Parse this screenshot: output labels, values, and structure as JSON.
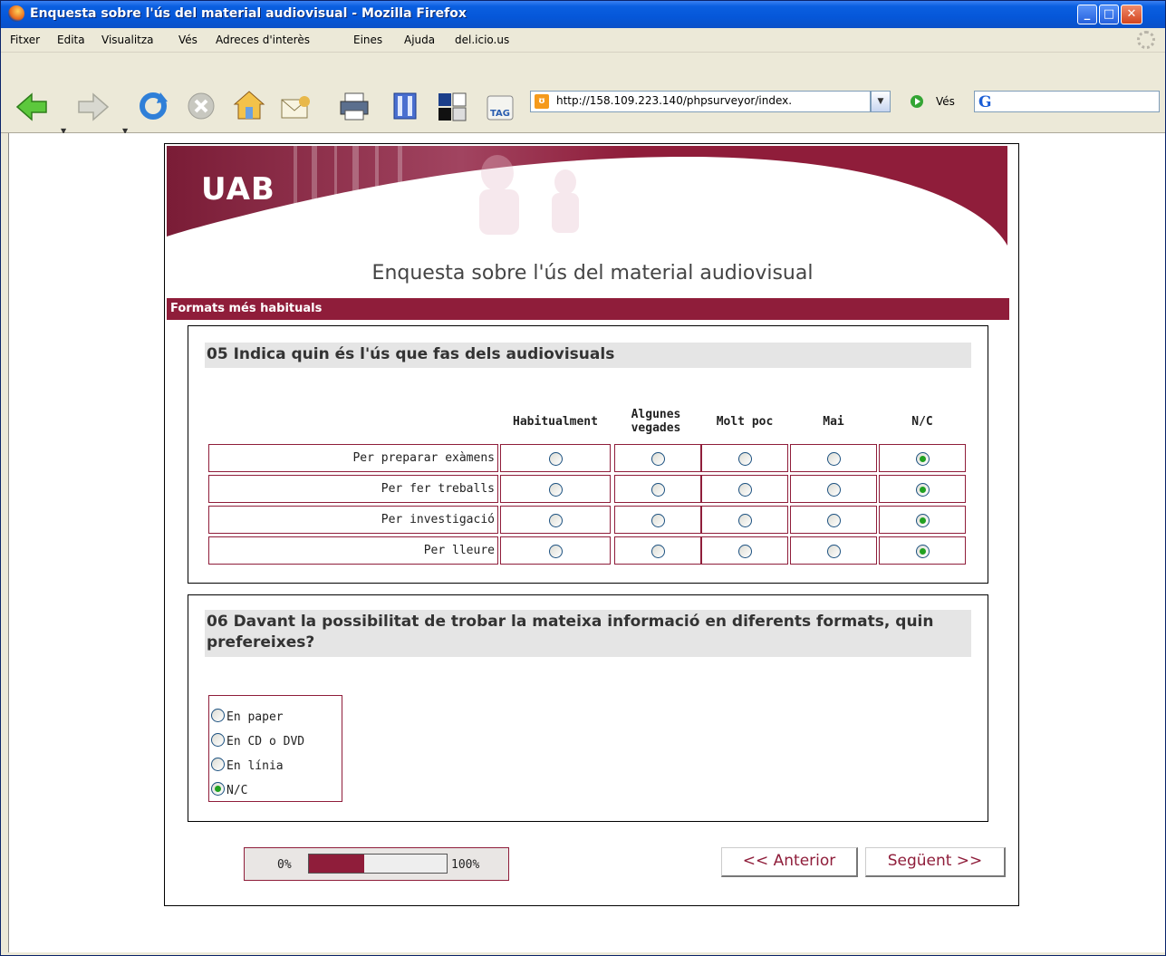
{
  "window": {
    "title": "Enquesta sobre l'ús del material audiovisual - Mozilla Firefox",
    "controls": {
      "minimize": "_",
      "maximize": "□",
      "close": "✕"
    }
  },
  "menubar": {
    "items": [
      "Fitxer",
      "Edita",
      "Visualitza",
      "Vés",
      "Adreces d'interès",
      "Eines",
      "Ajuda",
      "del.icio.us"
    ]
  },
  "toolbar": {
    "url": "http://158.109.223.140/phpsurveyor/index.",
    "go_label": "Vés",
    "search_engine": "G",
    "buttons": [
      "back",
      "forward",
      "reload",
      "stop",
      "home",
      "mail",
      "print",
      "bookmarks",
      "page-layout",
      "tag"
    ]
  },
  "page": {
    "logo": "UAB",
    "survey_title": "Enquesta sobre l'ús del material audiovisual",
    "group_title": "Formats més habituals",
    "colors": {
      "accent": "#8f1d3a",
      "radio_selected": "#21a121"
    }
  },
  "q5": {
    "title": "05 Indica quin és l'ús que fas dels audiovisuals",
    "columns": [
      "Habitualment",
      "Algunes vegades",
      "Molt poc",
      "Mai",
      "N/C"
    ],
    "rows": [
      {
        "label": "Per preparar exàmens",
        "selected": 4
      },
      {
        "label": "Per fer treballs",
        "selected": 4
      },
      {
        "label": "Per investigació",
        "selected": 4
      },
      {
        "label": "Per lleure",
        "selected": 4
      }
    ]
  },
  "q6": {
    "title": "06 Davant la possibilitat de trobar la mateixa informació en diferents formats, quin prefereixes?",
    "options": [
      {
        "label": "En paper",
        "selected": false
      },
      {
        "label": "En CD o DVD",
        "selected": false
      },
      {
        "label": "En línia",
        "selected": false
      },
      {
        "label": "N/C",
        "selected": true
      }
    ]
  },
  "progress": {
    "min_label": "0%",
    "max_label": "100%",
    "value_fraction": 0.4
  },
  "nav": {
    "prev_label": "<< Anterior",
    "next_label": "Següent >>"
  }
}
